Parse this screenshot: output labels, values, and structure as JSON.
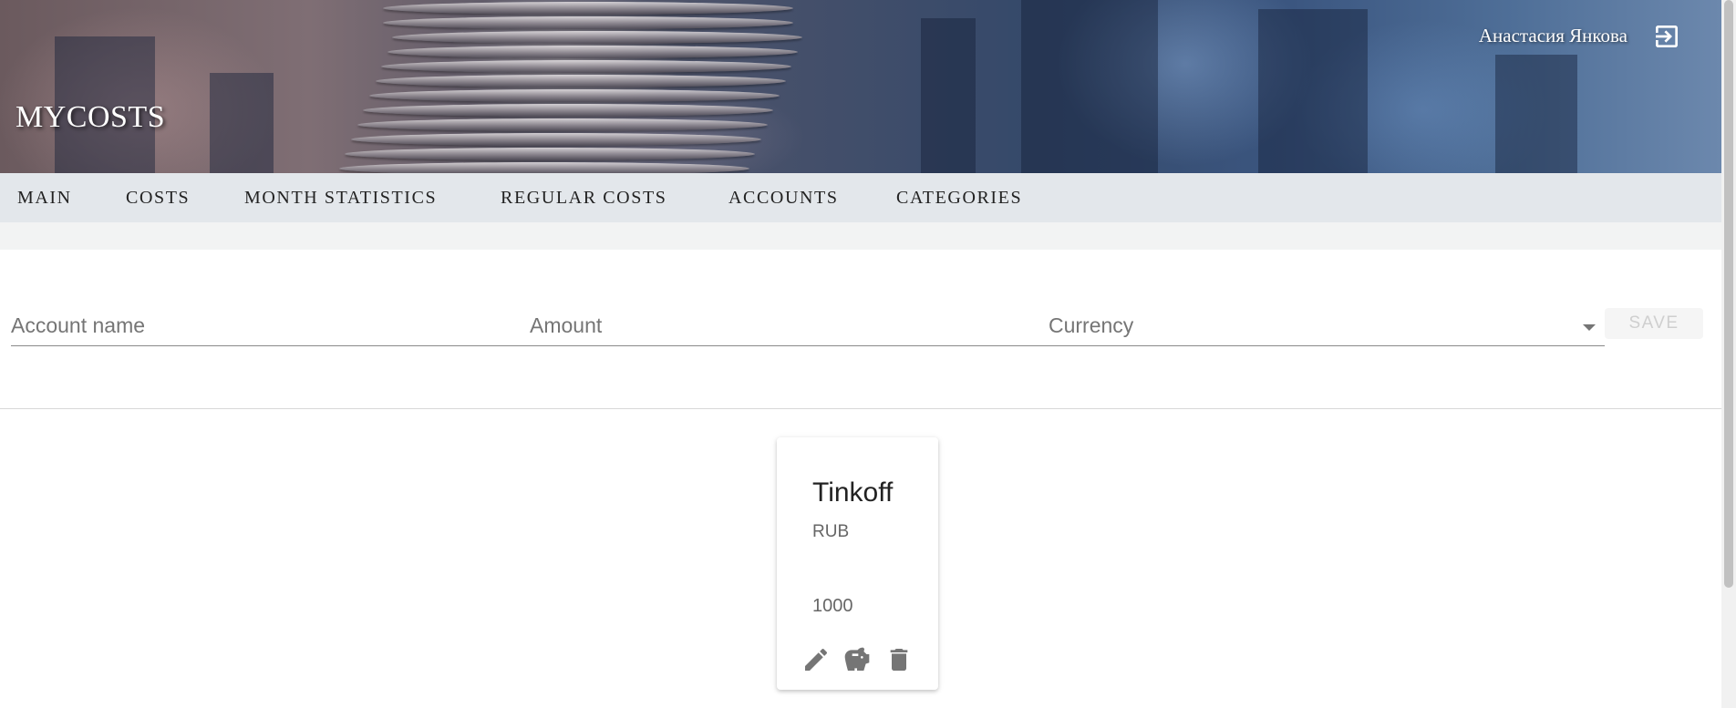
{
  "header": {
    "brand": "MYCOSTS",
    "user_name": "Анастасия Янкова",
    "logout_icon": "logout-icon"
  },
  "nav": {
    "items": [
      {
        "label": "MAIN"
      },
      {
        "label": "COSTS"
      },
      {
        "label": "MONTH STATISTICS"
      },
      {
        "label": "REGULAR COSTS"
      },
      {
        "label": "ACCOUNTS"
      },
      {
        "label": "CATEGORIES"
      }
    ]
  },
  "form": {
    "account_name": {
      "placeholder": "Account name",
      "value": ""
    },
    "amount": {
      "placeholder": "Amount",
      "value": ""
    },
    "currency": {
      "label": "Currency",
      "value": ""
    },
    "save_label": "SAVE"
  },
  "accounts": [
    {
      "name": "Tinkoff",
      "currency": "RUB",
      "amount": "1000",
      "actions": [
        "edit-icon",
        "piggy-bank-icon",
        "delete-icon"
      ]
    }
  ],
  "colors": {
    "nav_background": "#e3e7eb",
    "icon_gray": "#757575",
    "save_disabled_text": "#cfcfcf"
  }
}
